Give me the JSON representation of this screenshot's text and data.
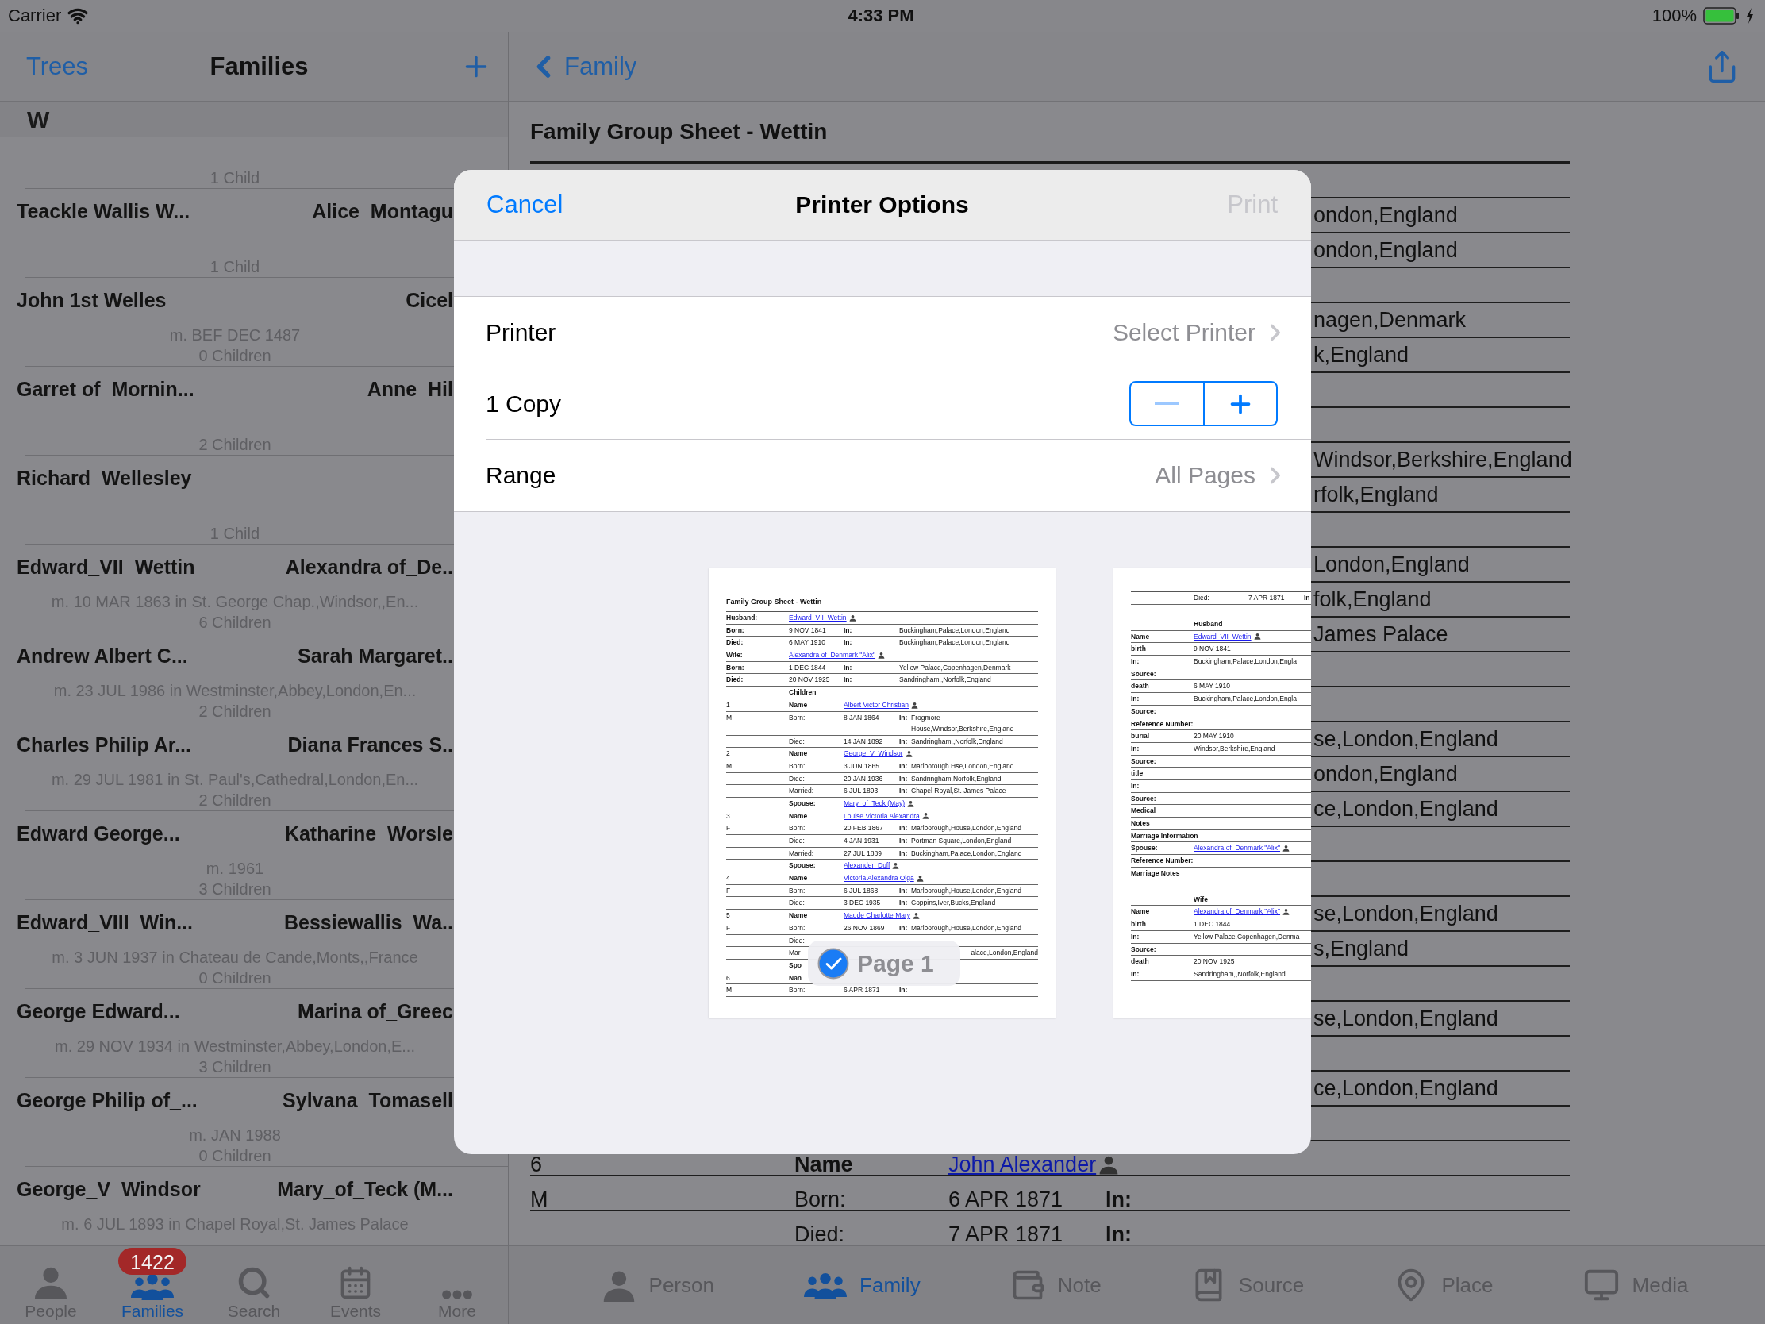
{
  "status_bar": {
    "carrier": "Carrier",
    "time": "4:33 PM",
    "battery": "100%"
  },
  "left_panel": {
    "nav": {
      "back": "Trees",
      "title": "Families"
    },
    "section": "W",
    "families": [
      {
        "children": "1 Child"
      },
      {
        "husband": "Teackle Wallis W...",
        "wife": "Alice  Montagu",
        "children": "1 Child"
      },
      {
        "husband": "John 1st Welles",
        "wife": "Cicel",
        "marriage": "m. BEF DEC 1487",
        "children": "0 Children"
      },
      {
        "husband": "Garret of_Mornin...",
        "wife": "Anne  Hil",
        "children": "2 Children"
      },
      {
        "husband": "Richard  Wellesley",
        "children": "1 Child"
      },
      {
        "husband": "Edward_VII  Wettin",
        "wife": "Alexandra of_De..",
        "marriage": "m. 10 MAR 1863 in St. George Chap.,Windsor,,En...",
        "children": "6 Children"
      },
      {
        "husband": "Andrew Albert C...",
        "wife": "Sarah Margaret..",
        "marriage": "m. 23 JUL 1986 in Westminster,Abbey,London,En...",
        "children": "2 Children"
      },
      {
        "husband": "Charles Philip Ar...",
        "wife": "Diana Frances S..",
        "marriage": "m. 29 JUL 1981 in St. Paul's,Cathedral,London,En...",
        "children": "2 Children"
      },
      {
        "husband": "Edward George...",
        "wife": "Katharine  Worsle",
        "marriage": "m. 1961",
        "children": "3 Children"
      },
      {
        "husband": "Edward_VIII  Win...",
        "wife": "Bessiewallis  Wa..",
        "marriage": "m. 3 JUN 1937 in Chateau de Cande,Monts,,France",
        "children": "0 Children"
      },
      {
        "husband": "George Edward...",
        "wife": "Marina of_Greec",
        "marriage": "m. 29 NOV 1934 in Westminster,Abbey,London,E...",
        "children": "3 Children"
      },
      {
        "husband": "George Philip of_...",
        "wife": "Sylvana  Tomasell",
        "marriage": "m. JAN 1988",
        "children": "0 Children"
      },
      {
        "husband": "George_V  Windsor",
        "wife": "Mary_of_Teck (M...",
        "marriage": "m. 6 JUL 1893 in Chapel Royal,St. James Palace"
      }
    ],
    "tabs": [
      {
        "label": "People",
        "selected": false
      },
      {
        "label": "Families",
        "selected": true,
        "badge": "1422"
      },
      {
        "label": "Search",
        "selected": false
      },
      {
        "label": "Events",
        "selected": false
      },
      {
        "label": "More",
        "selected": false
      }
    ]
  },
  "right_panel": {
    "nav": {
      "back": "Family"
    },
    "sheet": {
      "title": "Family Group Sheet - Wettin",
      "rows": [
        {
          "kind": "covered"
        },
        {
          "kind": "covered",
          "place": "ondon,England"
        },
        {
          "kind": "covered",
          "place": "ondon,England"
        },
        {
          "kind": "covered"
        },
        {
          "kind": "covered",
          "place": "nagen,Denmark"
        },
        {
          "kind": "covered",
          "place": "k,England"
        },
        {
          "kind": "covered"
        },
        {
          "kind": "covered"
        },
        {
          "kind": "covered",
          "place": "Windsor,Berkshire,England"
        },
        {
          "kind": "covered",
          "place": "rfolk,England"
        },
        {
          "kind": "covered"
        },
        {
          "kind": "covered",
          "place": "London,England"
        },
        {
          "kind": "covered",
          "place": "folk,England"
        },
        {
          "kind": "covered",
          "place": "James Palace"
        },
        {
          "kind": "covered"
        },
        {
          "kind": "covered"
        },
        {
          "kind": "covered",
          "place": "se,London,England"
        },
        {
          "kind": "covered",
          "place": "ondon,England"
        },
        {
          "kind": "covered",
          "place": "ce,London,England"
        },
        {
          "kind": "covered"
        },
        {
          "kind": "covered"
        },
        {
          "kind": "covered",
          "place": "se,London,England"
        },
        {
          "kind": "covered",
          "place": "s,England"
        },
        {
          "kind": "covered"
        },
        {
          "kind": "covered",
          "place": "se,London,England"
        },
        {
          "kind": "covered"
        },
        {
          "kind": "covered",
          "place": "ce,London,England"
        },
        {
          "kind": "covered"
        },
        {
          "kind": "child_name",
          "c1": "6",
          "label": "Name",
          "link": "John Alexander"
        },
        {
          "kind": "child_event",
          "c1": "M",
          "label": "Born:",
          "date": "6 APR 1871",
          "in": "In:"
        },
        {
          "kind": "child_event",
          "label": "Died:",
          "date": "7 APR 1871",
          "in": "In:"
        }
      ]
    },
    "tabs": [
      {
        "label": "Person",
        "selected": false
      },
      {
        "label": "Family",
        "selected": true
      },
      {
        "label": "Note",
        "selected": false
      },
      {
        "label": "Source",
        "selected": false
      },
      {
        "label": "Place",
        "selected": false
      },
      {
        "label": "Media",
        "selected": false
      }
    ]
  },
  "dialog": {
    "cancel": "Cancel",
    "title": "Printer Options",
    "print": "Print",
    "print_disabled": true,
    "options": [
      {
        "kind": "picker",
        "label": "Printer",
        "value": "Select Printer"
      },
      {
        "kind": "stepper",
        "label": "1 Copy",
        "decrement_disabled": true
      },
      {
        "kind": "picker",
        "label": "Range",
        "value": "All Pages"
      }
    ],
    "pages": [
      {
        "badge": {
          "label": "Page 1",
          "checked": true
        },
        "title": "Family Group Sheet - Wettin",
        "rows": [
          {
            "kind": "person",
            "label": "Husband:",
            "link": "Edward_VII  Wettin"
          },
          {
            "kind": "event",
            "label": "Born:",
            "date": "9 NOV 1841",
            "in": "In:",
            "place": "Buckingham,Palace,London,England"
          },
          {
            "kind": "event",
            "label": "Died:",
            "date": "6 MAY 1910",
            "in": "In:",
            "place": "Buckingham,Palace,London,England"
          },
          {
            "kind": "person",
            "label": "Wife:",
            "link": "Alexandra of_Denmark \"Alix\""
          },
          {
            "kind": "event",
            "label": "Born:",
            "date": "1 DEC 1844",
            "in": "In:",
            "place": "Yellow Palace,Copenhagen,Denmark"
          },
          {
            "kind": "event",
            "label": "Died:",
            "date": "20 NOV 1925",
            "in": "In:",
            "place": "Sandringham,,Norfolk,England"
          },
          {
            "kind": "heading",
            "label": "Children"
          },
          {
            "kind": "child_name",
            "c1": "1",
            "label": "Name",
            "link": "Albert Victor Christian"
          },
          {
            "kind": "child_event",
            "c1": "M",
            "label": "Born:",
            "date": "8 JAN 1864",
            "in": "In:",
            "place": "Frogmore House,Windsor,Berkshire,England"
          },
          {
            "kind": "child_event",
            "label": "Died:",
            "date": "14 JAN 1892",
            "in": "In:",
            "place": "Sandringham,,Norfolk,England"
          },
          {
            "kind": "child_name",
            "c1": "2",
            "label": "Name",
            "link": "George_V  Windsor"
          },
          {
            "kind": "child_event",
            "c1": "M",
            "label": "Born:",
            "date": "3 JUN 1865",
            "in": "In:",
            "place": "Marlborough Hse,London,England"
          },
          {
            "kind": "child_event",
            "label": "Died:",
            "date": "20 JAN 1936",
            "in": "In:",
            "place": "Sandringham,Norfolk,England"
          },
          {
            "kind": "child_event",
            "label": "Married:",
            "date": "6 JUL 1893",
            "in": "In:",
            "place": "Chapel Royal,St. James Palace"
          },
          {
            "kind": "child_name",
            "label": "Spouse:",
            "link": "Mary_of_Teck (May)"
          },
          {
            "kind": "child_name",
            "c1": "3",
            "label": "Name",
            "link": "Louise Victoria Alexandra"
          },
          {
            "kind": "child_event",
            "c1": "F",
            "label": "Born:",
            "date": "20 FEB 1867",
            "in": "In:",
            "place": "Marlborough,House,London,England"
          },
          {
            "kind": "child_event",
            "label": "Died:",
            "date": "4 JAN 1931",
            "in": "In:",
            "place": "Portman Square,London,England"
          },
          {
            "kind": "child_event",
            "label": "Married:",
            "date": "27 JUL 1889",
            "in": "In:",
            "place": "Buckingham,Palace,London,England"
          },
          {
            "kind": "child_name",
            "label": "Spouse:",
            "link": "Alexander  Duff"
          },
          {
            "kind": "child_name",
            "c1": "4",
            "label": "Name",
            "link": "Victoria Alexandra Olga"
          },
          {
            "kind": "child_event",
            "c1": "F",
            "label": "Born:",
            "date": "6 JUL 1868",
            "in": "In:",
            "place": "Marlborough,House,London,England"
          },
          {
            "kind": "child_event",
            "label": "Died:",
            "date": "3 DEC 1935",
            "in": "In:",
            "place": "Coppins,Iver,Bucks,England"
          },
          {
            "kind": "child_name",
            "c1": "5",
            "label": "Name",
            "link": "Maude Charlotte Mary"
          },
          {
            "kind": "child_event",
            "c1": "F",
            "label": "Born:",
            "date": "26 NOV 1869",
            "in": "In:",
            "place": "Marlborough,House,London,England"
          },
          {
            "kind": "child_event",
            "label": "Died:"
          },
          {
            "kind": "covered",
            "label": "Mar",
            "place": "alace,London,England"
          },
          {
            "kind": "child_name",
            "label": "Spo"
          },
          {
            "kind": "child_name",
            "c1": "6",
            "label": "Nan"
          },
          {
            "kind": "child_event",
            "c1": "M",
            "label": "Born:",
            "date": "6 APR 1871",
            "in": "In:"
          }
        ]
      },
      {
        "rows": [
          {
            "kind": "child_event",
            "label": "Died:",
            "date": "7 APR 1871",
            "in": "In"
          },
          {
            "kind": "section_heading",
            "label": "Husband"
          },
          {
            "kind": "field",
            "label": "Name",
            "link": "Edward_VII  Wettin"
          },
          {
            "kind": "field",
            "label": "birth",
            "value": "9 NOV 1841"
          },
          {
            "kind": "field",
            "label": "In:",
            "value": "Buckingham,Palace,London,Engla"
          },
          {
            "kind": "field",
            "label": "Source:"
          },
          {
            "kind": "field",
            "label": "death",
            "value": "6 MAY 1910"
          },
          {
            "kind": "field",
            "label": "In:",
            "value": "Buckingham,Palace,London,Engla"
          },
          {
            "kind": "field",
            "label": "Source:"
          },
          {
            "kind": "field",
            "label": "Reference Number:"
          },
          {
            "kind": "field",
            "label": "burial",
            "value": "20 MAY 1910"
          },
          {
            "kind": "field",
            "label": "In:",
            "value": "Windsor,Berkshire,England"
          },
          {
            "kind": "field",
            "label": "Source:"
          },
          {
            "kind": "field",
            "label": "title"
          },
          {
            "kind": "field",
            "label": "In:"
          },
          {
            "kind": "field",
            "label": "Source:"
          },
          {
            "kind": "field",
            "label": "Medical"
          },
          {
            "kind": "field",
            "label": "Notes"
          },
          {
            "kind": "section",
            "label": "Marriage Information"
          },
          {
            "kind": "field",
            "label": "Spouse:",
            "link": "Alexandra of_Denmark \"Alix\""
          },
          {
            "kind": "field",
            "label": "Reference Number:"
          },
          {
            "kind": "field",
            "label": "Marriage Notes"
          },
          {
            "kind": "section_heading",
            "label": "Wife"
          },
          {
            "kind": "field",
            "label": "Name",
            "link": "Alexandra of_Denmark \"Alix\""
          },
          {
            "kind": "field",
            "label": "birth",
            "value": "1 DEC 1844"
          },
          {
            "kind": "field",
            "label": "In:",
            "value": "Yellow Palace,Copenhagen,Denma"
          },
          {
            "kind": "field",
            "label": "Source:"
          },
          {
            "kind": "field",
            "label": "death",
            "value": "20 NOV 1925"
          },
          {
            "kind": "field",
            "label": "In:",
            "value": "Sandringham,,Norfolk,England"
          }
        ]
      }
    ]
  }
}
